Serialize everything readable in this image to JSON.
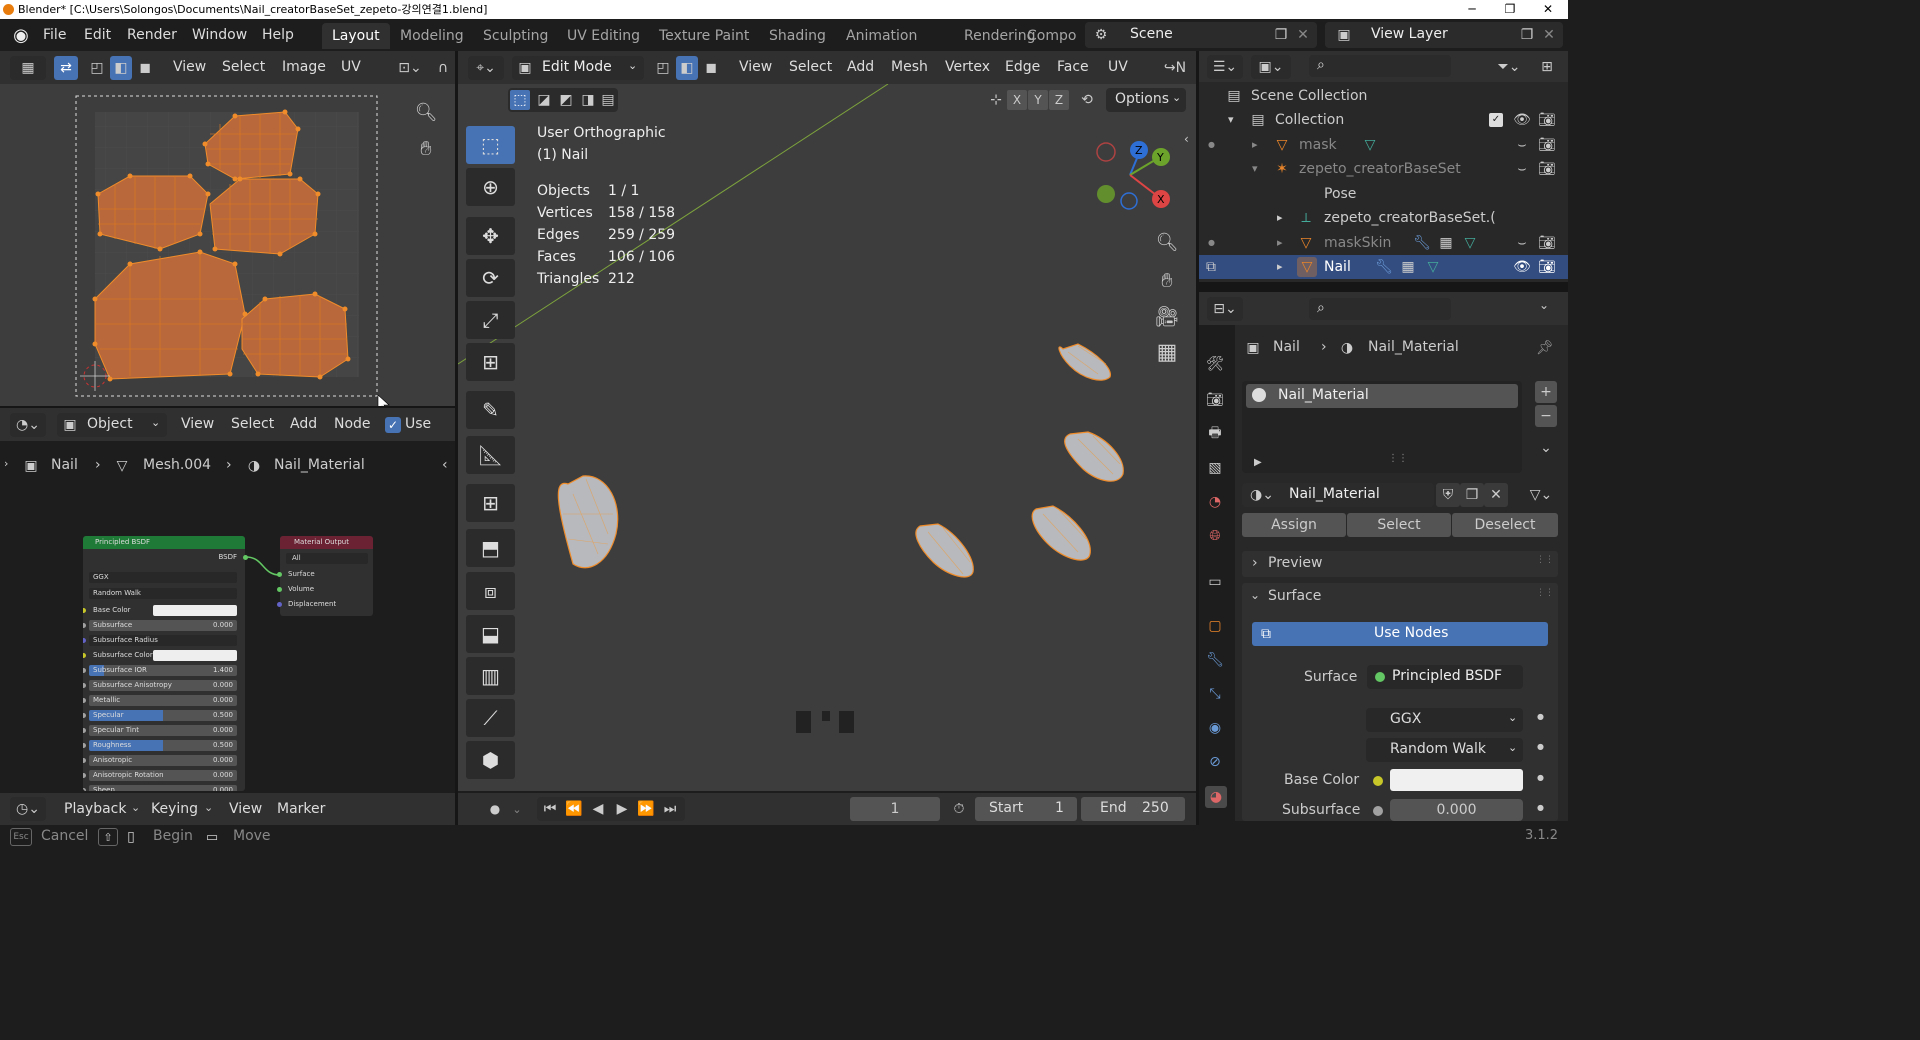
{
  "window": {
    "title": "Blender* [C:\\Users\\Solongos\\Documents\\Nail_creatorBaseSet_zepeto-강의연결1.blend]",
    "min": "─",
    "max": "❐",
    "close": "✕"
  },
  "menu": {
    "file": "File",
    "edit": "Edit",
    "render": "Render",
    "window": "Window",
    "help": "Help"
  },
  "workspaces": [
    "Layout",
    "Modeling",
    "Sculpting",
    "UV Editing",
    "Texture Paint",
    "Shading",
    "Animation",
    "Rendering",
    "Compo"
  ],
  "scene": {
    "name": "Scene",
    "view_layer": "View Layer"
  },
  "uv_editor": {
    "menu": [
      "View",
      "Select",
      "Image",
      "UV"
    ]
  },
  "node_editor": {
    "mode": "Object",
    "menu": [
      "View",
      "Select",
      "Add",
      "Node"
    ],
    "use_nodes": "Use No",
    "breadcrumb": [
      "Nail",
      "Mesh.004",
      "Nail_Material"
    ]
  },
  "nodes": {
    "principled": {
      "title": "Principled BSDF",
      "out": "BSDF",
      "dist": "GGX",
      "sss": "Random Walk",
      "rows": [
        [
          "Base Color",
          ""
        ],
        [
          "Subsurface",
          "0.000"
        ],
        [
          "Subsurface Radius",
          ""
        ],
        [
          "Subsurface Color",
          ""
        ],
        [
          "Subsurface IOR",
          "1.400"
        ],
        [
          "Subsurface Anisotropy",
          "0.000"
        ],
        [
          "Metallic",
          "0.000"
        ],
        [
          "Specular",
          "0.500"
        ],
        [
          "Specular Tint",
          "0.000"
        ],
        [
          "Roughness",
          "0.500"
        ],
        [
          "Anisotropic",
          "0.000"
        ],
        [
          "Anisotropic Rotation",
          "0.000"
        ],
        [
          "Sheen",
          "0.000"
        ]
      ]
    },
    "output": {
      "title": "Material Output",
      "target": "All",
      "inputs": [
        "Surface",
        "Volume",
        "Displacement"
      ]
    }
  },
  "viewport": {
    "mode": "Edit Mode",
    "menu": [
      "View",
      "Select",
      "Add",
      "Mesh",
      "Vertex",
      "Edge",
      "Face",
      "UV"
    ],
    "options": "Options",
    "axes": [
      "X",
      "Y",
      "Z"
    ],
    "view_name": "User Orthographic",
    "object": "(1) Nail",
    "stats": [
      [
        "Objects",
        "1 / 1"
      ],
      [
        "Vertices",
        "158 / 158"
      ],
      [
        "Edges",
        "259 / 259"
      ],
      [
        "Faces",
        "106 / 106"
      ],
      [
        "Triangles",
        "212"
      ]
    ],
    "gizmo": {
      "z": "Z",
      "y": "Y",
      "x": "X"
    }
  },
  "outliner": {
    "items": [
      {
        "label": "Scene Collection"
      },
      {
        "label": "Collection"
      },
      {
        "label": "mask"
      },
      {
        "label": "zepeto_creatorBaseSet"
      },
      {
        "label": "Pose"
      },
      {
        "label": "zepeto_creatorBaseSet.("
      },
      {
        "label": "maskSkin"
      },
      {
        "label": "Nail"
      }
    ]
  },
  "properties": {
    "object": "Nail",
    "material": "Nail_Material",
    "slot": "Nail_Material",
    "mat_field": "Nail_Material",
    "assign": "Assign",
    "select": "Select",
    "deselect": "Deselect",
    "preview": "Preview",
    "surface_panel": "Surface",
    "use_nodes": "Use Nodes",
    "surface_label": "Surface",
    "surface_val": "Principled BSDF",
    "dist": "GGX",
    "sss": "Random Walk",
    "base_color": "Base Color",
    "subsurface": "Subsurface",
    "subsurface_val": "0.000"
  },
  "timeline": {
    "menu": [
      "Playback",
      "Keying",
      "View",
      "Marker"
    ],
    "frame": "1",
    "start_label": "Start",
    "start": "1",
    "end_label": "End",
    "end": "250"
  },
  "statusbar": {
    "esc": "Esc",
    "cancel": "Cancel",
    "begin": "Begin",
    "move": "Move",
    "version": "3.1.2"
  },
  "colors": {
    "accent": "#4772b3",
    "orange": "#e8842a",
    "header": "#303030",
    "bg": "#1d1d1d"
  }
}
